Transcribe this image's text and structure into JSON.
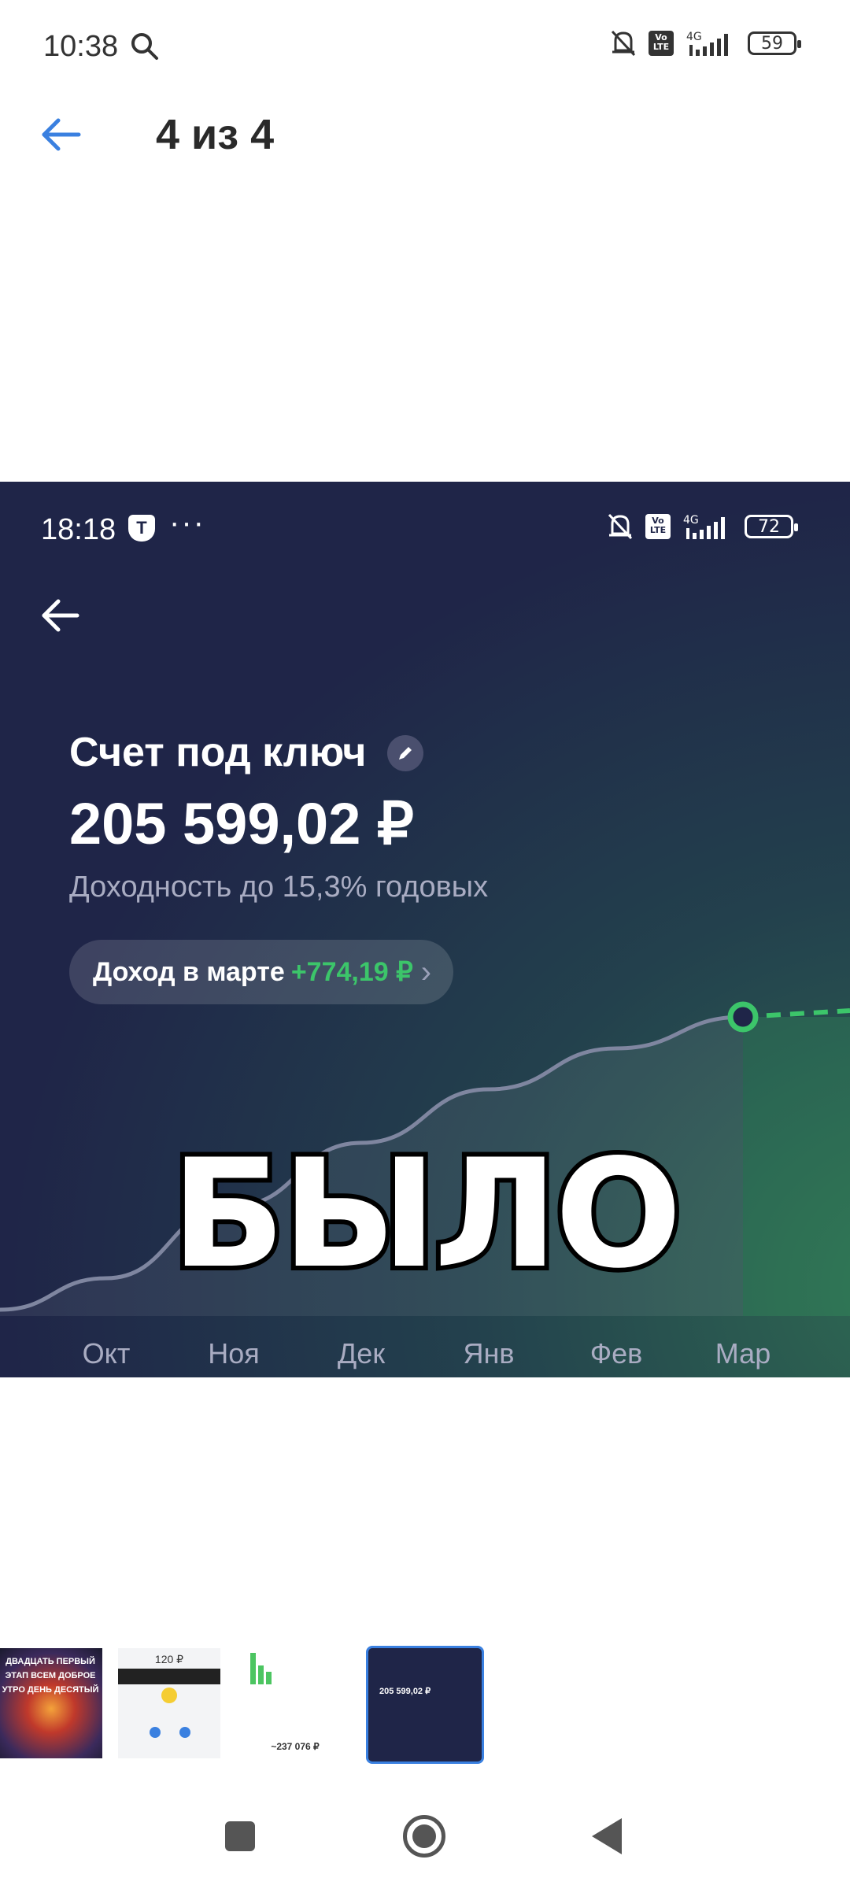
{
  "status_bar": {
    "time": "10:38",
    "battery": "59",
    "network": "4G",
    "volte": "Vo LTE"
  },
  "viewer": {
    "counter": "4 из 4"
  },
  "screenshot": {
    "status_bar": {
      "time": "18:18",
      "badge": "T",
      "dots": "···",
      "battery": "72",
      "network": "4G",
      "volte": "Vo LTE"
    },
    "account_title": "Счет под ключ",
    "balance": "205 599,02 ₽",
    "yield": "Доходность до 15,3% годовых",
    "income_label": "Доход в марте",
    "income_value": "+774,19 ₽",
    "overlay": "БЫЛО",
    "colors": {
      "background": "#1f2548",
      "accent_green": "#3cc56a",
      "line": "#7f86a0"
    }
  },
  "chart_data": {
    "type": "area",
    "categories": [
      "Окт",
      "Ноя",
      "Дек",
      "Янв",
      "Фев",
      "Мар"
    ],
    "series": [
      {
        "values": [
          0.12,
          0.35,
          0.55,
          0.72,
          0.85,
          0.95
        ]
      }
    ],
    "projection": "dashed line after Мар",
    "highlight": "Мар",
    "ylim": [
      0,
      1
    ]
  },
  "thumbnails": [
    {
      "label": "ДВАДЦАТЬ ПЕРВЫЙ ЭТАП ВСЕМ ДОБРОЕ УТРО ДЕНЬ ДЕСЯТЫЙ"
    },
    {
      "label": "120 ₽"
    },
    {
      "label": "~237 076 ₽"
    },
    {
      "label": "205 599,02 ₽"
    }
  ]
}
